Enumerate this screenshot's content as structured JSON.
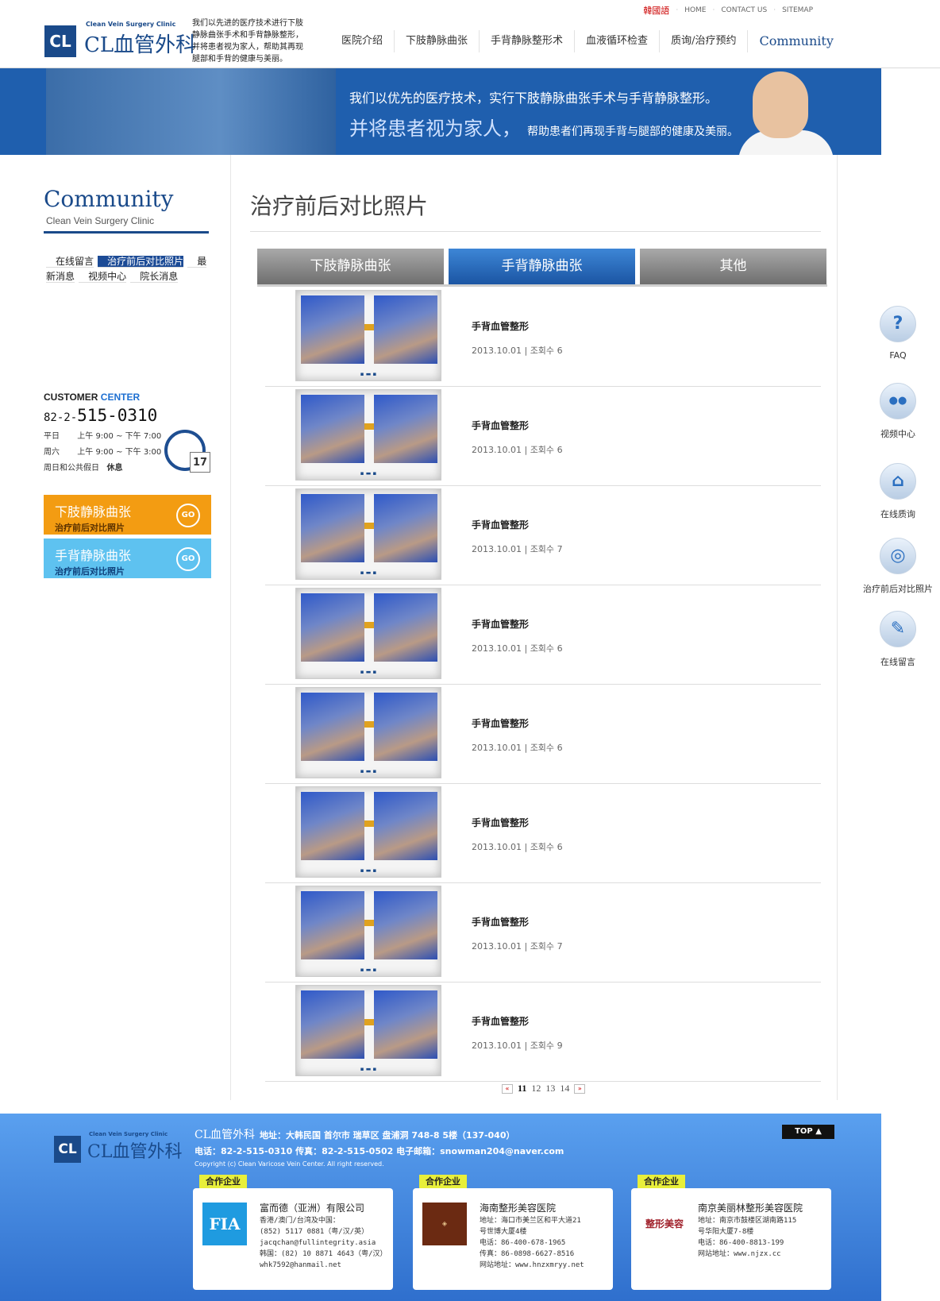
{
  "header": {
    "logo_en": "Clean Vein Surgery Clinic",
    "logo_mark": "CL",
    "logo_zh": "CL血管外科",
    "intro": "我们以先进的医疗技术进行下肢静脉曲张手术和手背静脉整形，并将患者视为家人，帮助其再现腿部和手背的健康与美丽。",
    "top_links": [
      "韓國語",
      "HOME",
      "CONTACT US",
      "SITEMAP"
    ],
    "gnb": [
      "医院介绍",
      "下肢静脉曲张",
      "手背静脉整形术",
      "血液循环检查",
      "质询/治疗预约",
      "Community"
    ]
  },
  "banner": {
    "line1": "我们以优先的医疗技术，实行下肢静脉曲张手术与手背静脉整形。",
    "line2_big": "并将患者视为家人，",
    "line2_small": "帮助患者们再现手背与腿部的健康及美丽。"
  },
  "sidebar": {
    "title": "Community",
    "subtitle": "Clean Vein Surgery Clinic",
    "menu": [
      "在线留言",
      "治疗前后对比照片",
      "最新消息",
      "视频中心",
      "院长消息"
    ],
    "active_index": 1,
    "customer_center": {
      "title_a": "CUSTOMER",
      "title_b": "CENTER",
      "tel_prefix": "82-2-",
      "tel_main": "515-0310",
      "weekday_label": "平日",
      "weekday_hours": "上午 9:00 ~ 下午 7:00",
      "saturday_label": "周六",
      "saturday_hours": "上午 9:00 ~ 下午 3:00",
      "holiday_label": "周日和公共假日",
      "holiday_status": "休息",
      "calendar_day": "17"
    },
    "promos": [
      {
        "title": "下肢静脉曲张",
        "sub": "治疗前后对比照片",
        "go": "GO"
      },
      {
        "title": "手背静脉曲张",
        "sub": "治疗前后对比照片",
        "go": "GO"
      }
    ]
  },
  "main": {
    "page_title": "治疗前后对比照片",
    "tabs": [
      "下肢静脉曲张",
      "手背静脉曲张",
      "其他"
    ],
    "active_tab": 1,
    "posts": [
      {
        "title": "手背血管整形",
        "date": "2013.10.01",
        "views_label": "조회수",
        "views": "6"
      },
      {
        "title": "手背血管整形",
        "date": "2013.10.01",
        "views_label": "조회수",
        "views": "6"
      },
      {
        "title": "手背血管整形",
        "date": "2013.10.01",
        "views_label": "조회수",
        "views": "7"
      },
      {
        "title": "手背血管整形",
        "date": "2013.10.01",
        "views_label": "조회수",
        "views": "6"
      },
      {
        "title": "手背血管整形",
        "date": "2013.10.01",
        "views_label": "조회수",
        "views": "6"
      },
      {
        "title": "手背血管整形",
        "date": "2013.10.01",
        "views_label": "조회수",
        "views": "6"
      },
      {
        "title": "手背血管整形",
        "date": "2013.10.01",
        "views_label": "조회수",
        "views": "7"
      },
      {
        "title": "手背血管整形",
        "date": "2013.10.01",
        "views_label": "조회수",
        "views": "9"
      }
    ],
    "pagination": {
      "prev": "«",
      "pages": [
        "11",
        "12",
        "13",
        "14"
      ],
      "current": "11",
      "next": "»"
    }
  },
  "quick_menu": [
    {
      "label": "FAQ",
      "icon": "question-icon",
      "glyph": "?"
    },
    {
      "label": "视频中心",
      "icon": "video-camera-icon",
      "glyph": "●●"
    },
    {
      "label": "在线质询",
      "icon": "house-icon",
      "glyph": "⌂"
    },
    {
      "label": "治疗前后对比照片",
      "icon": "camera-icon",
      "glyph": "◎"
    },
    {
      "label": "在线留言",
      "icon": "pen-note-icon",
      "glyph": "✎"
    }
  ],
  "footer": {
    "logo_en": "Clean Vein Surgery Clinic",
    "logo_mark": "CL",
    "logo_zh": "CL血管外科",
    "name": "CL血管外科",
    "address": "地址：大韩民国 首尔市 瑞草区 盘浦洞 748-8 5楼（137-040）",
    "contacts": "电话：82-2-515-0310  传真：82-2-515-0502  电子邮箱：snowman204@naver.com",
    "copyright": "Copyright (c) Clean Varicose Vein Center. All right reserved.",
    "top_button": "TOP ▲",
    "partners": [
      {
        "tag": "合作企业",
        "logo_text": "FIA",
        "name": "富而德（亚洲）有限公司",
        "lines": [
          "香港/澳门/台湾及中国：",
          "(852) 5117 0881（粤/汉/英）",
          "jacqchan@fullintegrity.asia",
          "韩国：(82) 10 8871 4643（粤/汉）",
          "whk7592@hanmail.net"
        ]
      },
      {
        "tag": "合作企业",
        "logo_text": "",
        "name": "海南整形美容医院",
        "lines": [
          "地址：海口市美兰区和平大道21",
          "号世博大厦4楼",
          "电话：86-400-678-1965",
          "传真：86-0898-6627-8516",
          "网站地址：www.hnzxmryy.net"
        ]
      },
      {
        "tag": "合作企业",
        "logo_text": "整形美容",
        "name": "南京美丽林整形美容医院",
        "lines": [
          "地址：南京市鼓楼区湖南路115",
          "号华阳大厦7-8楼",
          "电话：86-400-8813-199",
          "网站地址：www.njzx.cc"
        ]
      }
    ]
  }
}
